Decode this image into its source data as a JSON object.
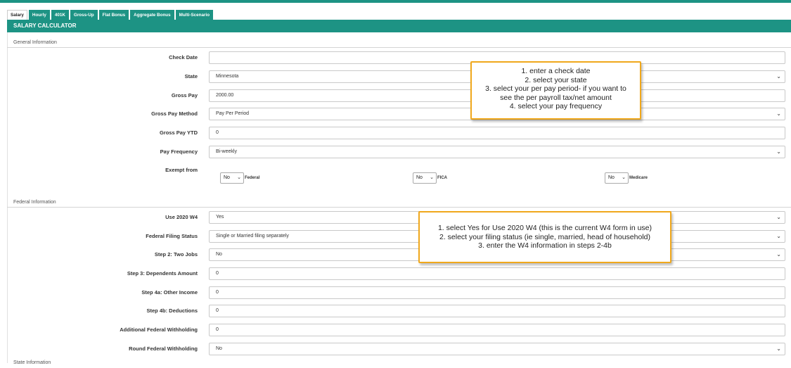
{
  "tabs": [
    "Salary",
    "Hourly",
    "401K",
    "Gross-Up",
    "Flat Bonus",
    "Aggregate Bonus",
    "Multi-Scenario"
  ],
  "header": {
    "title": "SALARY CALCULATOR"
  },
  "general": {
    "section_title": "General Information",
    "check_date": {
      "label": "Check Date",
      "value": ""
    },
    "state": {
      "label": "State",
      "value": "Minnesota"
    },
    "gross_pay": {
      "label": "Gross Pay",
      "value": "2000.00"
    },
    "gross_pay_method": {
      "label": "Gross Pay Method",
      "value": "Pay Per Period"
    },
    "gross_pay_ytd": {
      "label": "Gross Pay YTD",
      "value": "0"
    },
    "pay_frequency": {
      "label": "Pay Frequency",
      "value": "Bi-weekly"
    },
    "exempt": {
      "label": "Exempt from",
      "federal": {
        "value": "No",
        "label": "Federal"
      },
      "fica": {
        "value": "No",
        "label": "FICA"
      },
      "medicare": {
        "value": "No",
        "label": "Medicare"
      }
    }
  },
  "federal": {
    "section_title": "Federal Information",
    "use_2020_w4": {
      "label": "Use 2020 W4",
      "value": "Yes"
    },
    "filing_status": {
      "label": "Federal Filing Status",
      "value": "Single or Married filing separately"
    },
    "step2": {
      "label": "Step 2: Two Jobs",
      "value": "No"
    },
    "step3": {
      "label": "Step 3: Dependents Amount",
      "value": "0"
    },
    "step4a": {
      "label": "Step 4a: Other Income",
      "value": "0"
    },
    "step4b": {
      "label": "Step 4b: Deductions",
      "value": "0"
    },
    "additional_withholding": {
      "label": "Additional Federal Withholding",
      "value": "0"
    },
    "round_withholding": {
      "label": "Round Federal Withholding",
      "value": "No"
    }
  },
  "state_section": {
    "section_title": "State Information"
  },
  "callout1": {
    "lines": [
      "1. enter a check date",
      "2. select your state",
      "3. select your per pay period- if you want to",
      "see the per payroll tax/net amount",
      "4. select your pay frequency"
    ]
  },
  "callout2": {
    "lines": [
      "1. select Yes for Use 2020 W4 (this is the current W4 form in  use)",
      "2. select your filing status (ie single, married, head of household)",
      "3. enter the W4 information in steps 2-4b"
    ]
  },
  "colors": {
    "accent": "#1d9384",
    "callout_border": "#f0a81c"
  },
  "icons": {
    "dropdown": "chevron-down-icon"
  }
}
